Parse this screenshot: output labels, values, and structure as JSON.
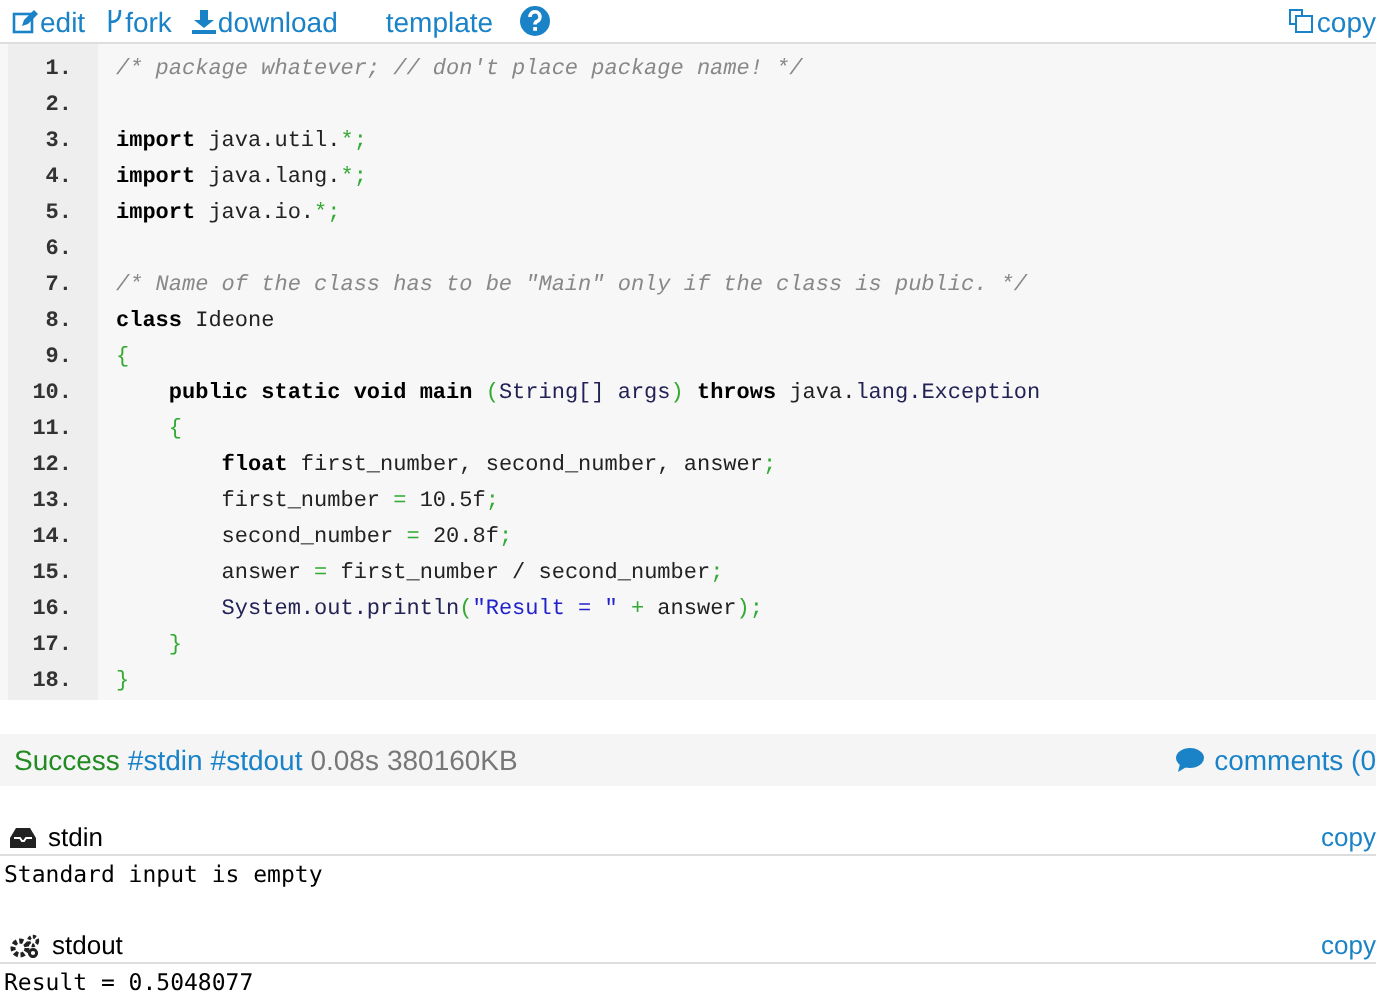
{
  "toolbar": {
    "links": [
      {
        "kind": "edit",
        "label": "edit"
      },
      {
        "kind": "fork",
        "label": "fork"
      },
      {
        "kind": "download",
        "label": "download"
      },
      {
        "kind": "plain",
        "label": "template"
      },
      {
        "kind": "help"
      }
    ],
    "copy": "copy"
  },
  "code": {
    "lines": [
      {
        "number": "1.",
        "tokens": [
          {
            "kind": "comment",
            "text": "/* package whatever; // don't place package name! */"
          }
        ]
      },
      {
        "number": "2."
      },
      {
        "number": "3.",
        "tokens": [
          {
            "kind": "keyword",
            "text": "import"
          },
          {
            "kind": "ident",
            "text": " java.util."
          },
          {
            "kind": "punct",
            "text": "*;"
          }
        ]
      },
      {
        "number": "4.",
        "tokens": [
          {
            "kind": "keyword",
            "text": "import"
          },
          {
            "kind": "ident",
            "text": " java.lang."
          },
          {
            "kind": "punct",
            "text": "*;"
          }
        ]
      },
      {
        "number": "5.",
        "tokens": [
          {
            "kind": "keyword",
            "text": "import"
          },
          {
            "kind": "ident",
            "text": " java.io."
          },
          {
            "kind": "punct",
            "text": "*;"
          }
        ]
      },
      {
        "number": "6."
      },
      {
        "number": "7.",
        "tokens": [
          {
            "kind": "comment",
            "text": "/* Name of the class has to be \"Main\" only if the class is public. */"
          }
        ]
      },
      {
        "number": "8.",
        "tokens": [
          {
            "kind": "keyword",
            "text": "class"
          },
          {
            "kind": "ident",
            "text": " Ideone"
          }
        ]
      },
      {
        "number": "9.",
        "tokens": [
          {
            "kind": "punct",
            "text": "{"
          }
        ]
      },
      {
        "number": "10.",
        "tokens": [
          {
            "kind": "keyword",
            "text": "    public static void main"
          },
          {
            "kind": "punct",
            "text": " ("
          },
          {
            "kind": "type",
            "text": "String[] args"
          },
          {
            "kind": "punct",
            "text": ")"
          },
          {
            "kind": "keyword",
            "text": " throws"
          },
          {
            "kind": "ident",
            "text": " java."
          },
          {
            "kind": "type",
            "text": "lang.Exception"
          }
        ]
      },
      {
        "number": "11.",
        "tokens": [
          {
            "kind": "punct",
            "text": "    {"
          }
        ]
      },
      {
        "number": "12.",
        "tokens": [
          {
            "kind": "keyword",
            "text": "        float"
          },
          {
            "kind": "ident",
            "text": " first_number, second_number, answer"
          },
          {
            "kind": "punct",
            "text": ";"
          }
        ]
      },
      {
        "number": "13.",
        "tokens": [
          {
            "kind": "ident",
            "text": "        first_number "
          },
          {
            "kind": "punct",
            "text": "="
          },
          {
            "kind": "ident",
            "text": " 10.5f"
          },
          {
            "kind": "punct",
            "text": ";"
          }
        ]
      },
      {
        "number": "14.",
        "tokens": [
          {
            "kind": "ident",
            "text": "        second_number "
          },
          {
            "kind": "punct",
            "text": "="
          },
          {
            "kind": "ident",
            "text": " 20.8f"
          },
          {
            "kind": "punct",
            "text": ";"
          }
        ]
      },
      {
        "number": "15.",
        "tokens": [
          {
            "kind": "ident",
            "text": "        answer "
          },
          {
            "kind": "punct",
            "text": "="
          },
          {
            "kind": "ident",
            "text": " first_number / second_number"
          },
          {
            "kind": "punct",
            "text": ";"
          }
        ]
      },
      {
        "number": "16.",
        "tokens": [
          {
            "kind": "type",
            "text": "        System.out.println"
          },
          {
            "kind": "punct",
            "text": "("
          },
          {
            "kind": "string",
            "text": "\"Result = \""
          },
          {
            "kind": "punct",
            "text": " +"
          },
          {
            "kind": "ident",
            "text": " answer"
          },
          {
            "kind": "punct",
            "text": ");"
          }
        ]
      },
      {
        "number": "17.",
        "tokens": [
          {
            "kind": "punct",
            "text": "    }"
          }
        ]
      },
      {
        "number": "18.",
        "tokens": [
          {
            "kind": "punct",
            "text": "}"
          }
        ]
      }
    ]
  },
  "status": {
    "result": "Success",
    "tags": [
      "#stdin",
      "#stdout"
    ],
    "time": "0.08s",
    "memory": "380160KB",
    "comments": "comments (0"
  },
  "panels": [
    {
      "kind": "stdin",
      "title": "stdin",
      "copy": "copy",
      "content": "Standard input is empty"
    },
    {
      "kind": "stdout",
      "title": "stdout",
      "copy": "copy",
      "content": "Result = 0.5048077"
    }
  ]
}
